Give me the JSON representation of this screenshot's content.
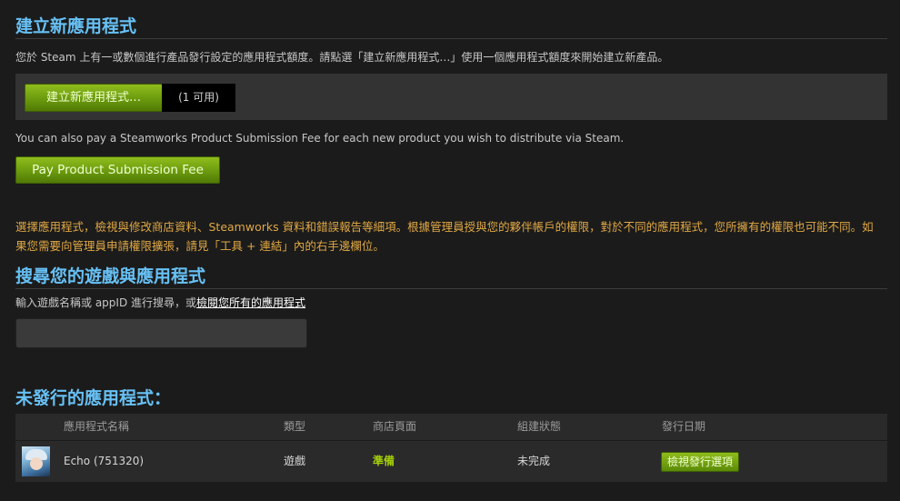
{
  "create": {
    "title": "建立新應用程式",
    "description": "您於 Steam 上有一或數個進行產品發行設定的應用程式額度。請點選「建立新應用程式…」使用一個應用程式額度來開始建立新產品。",
    "button_label": "建立新應用程式…",
    "available_label": "(1 可用)"
  },
  "fee": {
    "text": "You can also pay a Steamworks Product Submission Fee for each new product you wish to distribute via Steam.",
    "button_label": "Pay Product Submission Fee"
  },
  "notice": {
    "text": "選擇應用程式，檢視與修改商店資料、Steamworks 資料和錯誤報告等細項。根據管理員授與您的夥伴帳戶的權限，對於不同的應用程式，您所擁有的權限也可能不同。如果您需要向管理員申請權限擴張，請見「工具 + 連結」內的右手邊欄位。"
  },
  "search": {
    "title": "搜尋您的遊戲與應用程式",
    "hint_prefix": "輸入遊戲名稱或 appID 進行搜尋，或",
    "hint_link": "檢閱您所有的應用程式",
    "value": ""
  },
  "unreleased": {
    "title": "未發行的應用程式：",
    "columns": [
      "應用程式名稱",
      "類型",
      "商店頁面",
      "組建狀態",
      "發行日期"
    ],
    "rows": [
      {
        "name": "Echo (751320)",
        "type": "遊戲",
        "store": "準備",
        "build": "未完成",
        "action": "檢視發行選項"
      }
    ]
  },
  "colors": {
    "heading": "#67c1f5",
    "notice": "#e0a844",
    "ready": "#a4d007",
    "button_green": "#6b9a0e"
  }
}
